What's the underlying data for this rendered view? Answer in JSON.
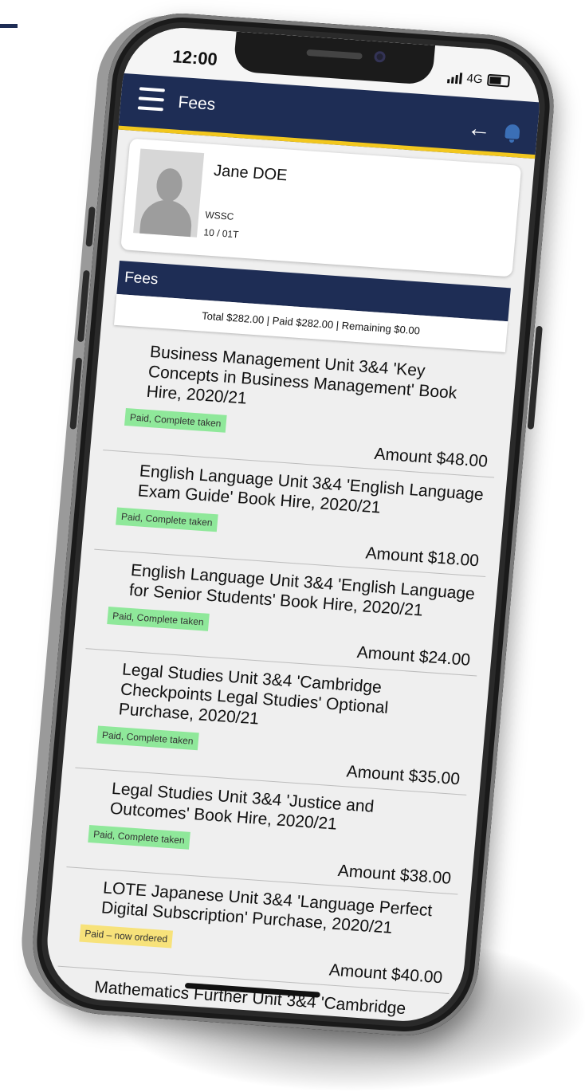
{
  "status_bar": {
    "time": "12:00",
    "network": "4G"
  },
  "app_bar": {
    "title": "Fees"
  },
  "student": {
    "name": "Jane DOE",
    "school": "WSSC",
    "class": "10 / 01T"
  },
  "fees": {
    "section_title": "Fees",
    "totals": "Total $282.00 | Paid $282.00 | Remaining $0.00",
    "items": [
      {
        "description": "Business Management Unit 3&4 'Key Concepts in Business Management' Book Hire, 2020/21",
        "status": "Paid, Complete taken",
        "amount": "Amount $48.00"
      },
      {
        "description": "English Language Unit 3&4 'English Language Exam Guide' Book Hire, 2020/21",
        "status": "Paid, Complete taken",
        "amount": "Amount $18.00"
      },
      {
        "description": "English Language Unit 3&4 'English Language for Senior Students' Book Hire, 2020/21",
        "status": "Paid, Complete taken",
        "amount": "Amount $24.00"
      },
      {
        "description": "Legal Studies Unit 3&4 'Cambridge Checkpoints Legal Studies' Optional Purchase, 2020/21",
        "status": "Paid, Complete taken",
        "amount": "Amount $35.00"
      },
      {
        "description": "Legal Studies Unit 3&4 'Justice and Outcomes' Book Hire, 2020/21",
        "status": "Paid, Complete taken",
        "amount": "Amount $38.00"
      },
      {
        "description": "LOTE Japanese Unit 3&4 'Language Perfect Digital Subscription' Purchase, 2020/21",
        "status": "Paid – now ordered",
        "amount": "Amount $40.00"
      },
      {
        "description": "Mathematics Further Unit 3&4 'Cambridge",
        "status": "",
        "amount": ""
      }
    ]
  },
  "colors": {
    "primary": "#1e2d55",
    "accent": "#f2c71e",
    "paid": "#8fe89a",
    "ordered": "#f7e27a",
    "bell": "#3b6fb6"
  },
  "icons": [
    "hamburger-menu-icon",
    "back-arrow-icon",
    "bell-icon",
    "signal-icon",
    "battery-icon",
    "avatar-placeholder-icon"
  ]
}
